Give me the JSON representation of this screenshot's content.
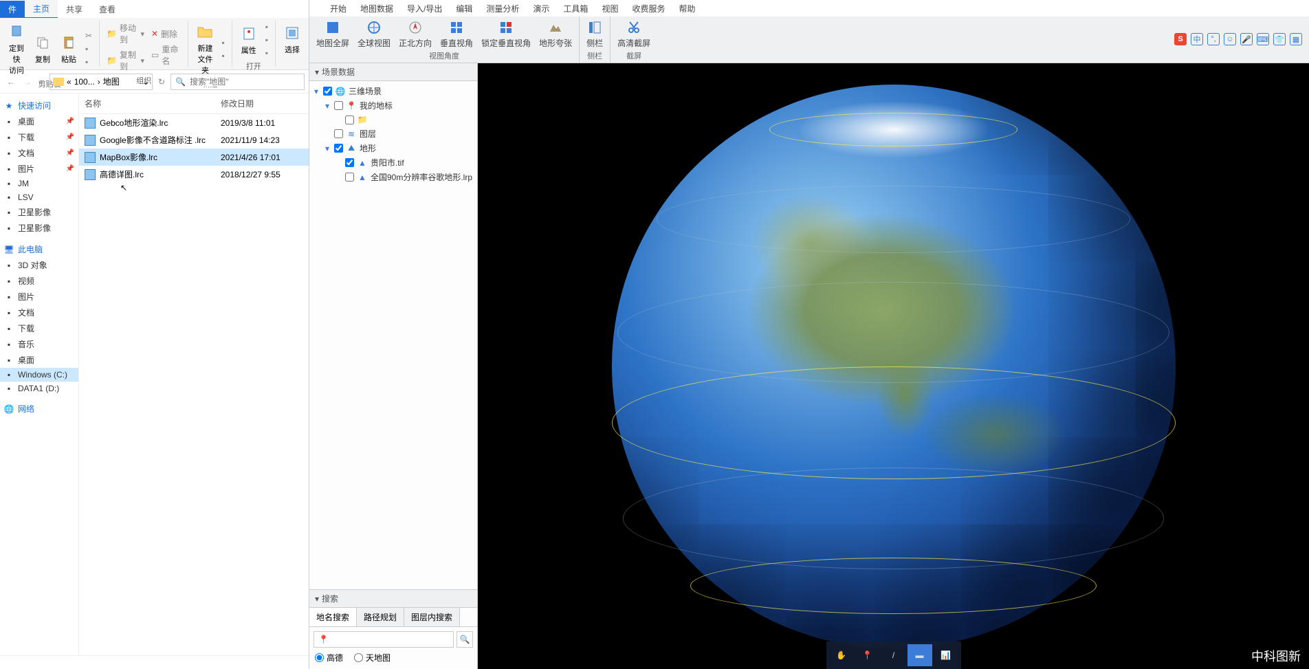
{
  "explorer": {
    "tabs": {
      "file": "件",
      "home": "主页",
      "share": "共享",
      "view": "查看"
    },
    "ribbon": {
      "pin": "定到快\n访问",
      "copy": "复制",
      "paste": "粘贴",
      "moveTo": "移动到",
      "copyTo": "复制到",
      "delete": "删除",
      "rename": "重命名",
      "newFolder": "新建\n文件夹",
      "properties": "属性",
      "select": "选择",
      "groups": {
        "clipboard": "剪贴板",
        "organize": "组织",
        "new": "新建",
        "open": "打开"
      }
    },
    "nav": {
      "path1": "100...",
      "path2": "地图",
      "searchPlaceholder": "搜索\"地图\""
    },
    "columns": {
      "name": "名称",
      "date": "修改日期"
    },
    "files": [
      {
        "name": "Gebco地形渲染.lrc",
        "date": "2019/3/8 11:01"
      },
      {
        "name": "Google影像不含道路标注 .lrc",
        "date": "2021/11/9 14:23"
      },
      {
        "name": "MapBox影像.lrc",
        "date": "2021/4/26 17:01"
      },
      {
        "name": "高德详图.lrc",
        "date": "2018/12/27 9:55"
      }
    ],
    "navPane": {
      "quickAccess": "快速访问",
      "quick": [
        {
          "name": "桌面"
        },
        {
          "name": "下载"
        },
        {
          "name": "文档"
        },
        {
          "name": "图片"
        },
        {
          "name": "JM"
        },
        {
          "name": "LSV"
        },
        {
          "name": "卫星影像"
        },
        {
          "name": "卫星影像"
        }
      ],
      "thisPC": "此电脑",
      "pc": [
        {
          "name": "3D 对象"
        },
        {
          "name": "视频"
        },
        {
          "name": "图片"
        },
        {
          "name": "文档"
        },
        {
          "name": "下载"
        },
        {
          "name": "音乐"
        },
        {
          "name": "桌面"
        },
        {
          "name": "Windows (C:)"
        },
        {
          "name": "DATA1 (D:)"
        }
      ],
      "network": "网络"
    }
  },
  "app": {
    "menu": [
      "开始",
      "地图数据",
      "导入/导出",
      "编辑",
      "测量分析",
      "演示",
      "工具箱",
      "视图",
      "收费服务",
      "帮助"
    ],
    "ribbon": {
      "fullMap": "地图全屏",
      "globalView": "全球视图",
      "northUp": "正北方向",
      "vertView": "垂直视角",
      "lockVert": "锁定垂直视角",
      "terrainEx": "地形夸张",
      "sidebar": "侧栏",
      "screenshot": "高清截屏",
      "groups": {
        "viewAngle": "视图角度",
        "sidebar": "侧栏",
        "screenshot": "截屏"
      }
    },
    "ime": {
      "label": "中"
    },
    "scenePanel": {
      "title": "场景数据",
      "root": "三维场景",
      "myPlaces": "我的地标",
      "layers": "图层",
      "terrain": "地形",
      "terrainItems": [
        "贵阳市.tif",
        "全国90m分辨率谷歌地形.lrp"
      ]
    },
    "searchPanel": {
      "title": "搜索",
      "tabs": [
        "地名搜索",
        "路径规划",
        "图层内搜索"
      ],
      "radios": [
        "高德",
        "天地图"
      ]
    },
    "watermark": "中科图新"
  }
}
